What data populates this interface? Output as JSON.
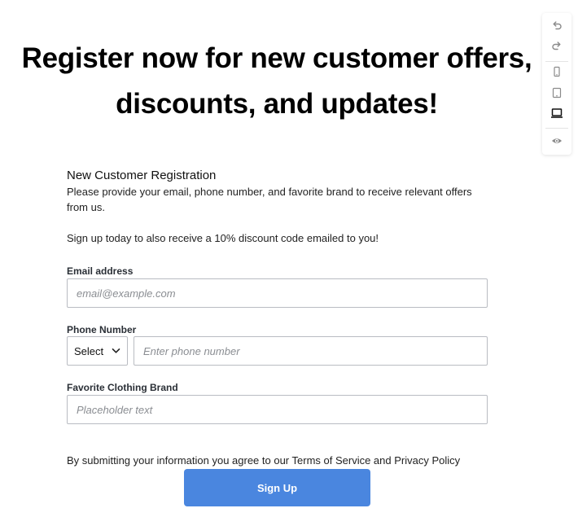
{
  "hero": {
    "title": "Register now for new customer offers, discounts, and updates!"
  },
  "form": {
    "heading": "New Customer Registration",
    "description": "Please provide your email, phone number, and favorite brand to receive relevant offers from us.",
    "description_2": "Sign up today to also receive a 10% discount code emailed to you!",
    "email": {
      "label": "Email address",
      "placeholder": "email@example.com",
      "value": ""
    },
    "phone": {
      "label": "Phone Number",
      "select_value": "Select",
      "placeholder": "Enter phone number",
      "value": ""
    },
    "brand": {
      "label": "Favorite Clothing Brand",
      "placeholder": "Placeholder text",
      "value": ""
    },
    "legal": "By submitting your information you agree to our Terms of Service and Privacy Policy",
    "submit_label": "Sign Up"
  },
  "toolbar": {
    "items": [
      "undo-icon",
      "redo-icon",
      "mobile-view-icon",
      "tablet-view-icon",
      "desktop-view-icon",
      "preview-eye-icon"
    ],
    "active_item": "desktop-view-icon"
  },
  "colors": {
    "accent": "#4a86df",
    "border": "#b9bcc2",
    "label": "#2a2f36"
  }
}
